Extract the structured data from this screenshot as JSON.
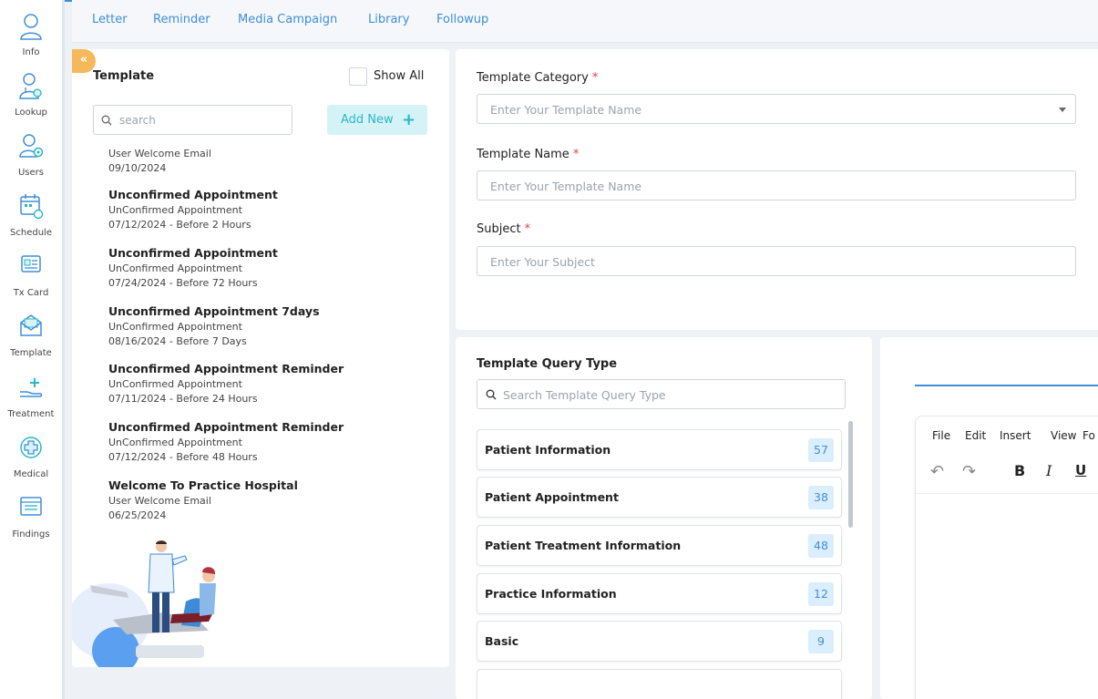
{
  "sidebar": {
    "items": [
      {
        "label": "Info",
        "icon": "person-icon"
      },
      {
        "label": "Lookup",
        "icon": "doctor-icon"
      },
      {
        "label": "Users",
        "icon": "users-gear-icon"
      },
      {
        "label": "Schedule",
        "icon": "calendar-icon"
      },
      {
        "label": "Tx Card",
        "icon": "card-icon"
      },
      {
        "label": "Template",
        "icon": "envelope-icon"
      },
      {
        "label": "Treatment",
        "icon": "hand-plus-icon"
      },
      {
        "label": "Medical",
        "icon": "medical-cross-icon"
      },
      {
        "label": "Findings",
        "icon": "findings-list-icon"
      }
    ]
  },
  "tabs": [
    "Letter",
    "Reminder",
    "Media Campaign",
    "Library",
    "Followup"
  ],
  "template_panel": {
    "collapse_glyph": "«",
    "title": "Template",
    "show_all_label": "Show All",
    "search_placeholder": "search",
    "add_new_label": "Add New",
    "add_new_icon": "+",
    "items": [
      {
        "name": "",
        "subtitle": "User Welcome Email",
        "date": "09/10/2024"
      },
      {
        "name": "Unconfirmed Appointment",
        "subtitle": "UnConfirmed Appointment",
        "date": "07/12/2024 - Before 2 Hours"
      },
      {
        "name": "Unconfirmed Appointment",
        "subtitle": "UnConfirmed Appointment",
        "date": "07/24/2024 - Before 72 Hours"
      },
      {
        "name": "Unconfirmed Appointment 7days",
        "subtitle": "UnConfirmed Appointment",
        "date": "08/16/2024 - Before 7 Days"
      },
      {
        "name": "Unconfirmed Appointment Reminder",
        "subtitle": "UnConfirmed Appointment",
        "date": "07/11/2024 - Before 24 Hours"
      },
      {
        "name": "Unconfirmed Appointment Reminder",
        "subtitle": "UnConfirmed Appointment",
        "date": "07/12/2024 - Before 48 Hours"
      },
      {
        "name": "Welcome To Practice Hospital",
        "subtitle": "User Welcome Email",
        "date": "06/25/2024"
      }
    ]
  },
  "form": {
    "category_label": "Template Category",
    "category_placeholder": "Enter Your Template Name",
    "name_label": "Template Name",
    "name_placeholder": "Enter Your Template Name",
    "subject_label": "Subject",
    "subject_placeholder": "Enter Your Subject",
    "required_mark": "*"
  },
  "query_panel": {
    "title": "Template Query Type",
    "search_placeholder": "Search Template Query Type",
    "items": [
      {
        "name": "Patient Information",
        "count": "57"
      },
      {
        "name": "Patient Appointment",
        "count": "38"
      },
      {
        "name": "Patient Treatment Information",
        "count": "48"
      },
      {
        "name": "Practice Information",
        "count": "12"
      },
      {
        "name": "Basic",
        "count": "9"
      }
    ]
  },
  "editor": {
    "menus": [
      "File",
      "Edit",
      "Insert",
      "View",
      "Fo"
    ],
    "tools": {
      "undo": "↶",
      "redo": "↷",
      "bold": "B",
      "italic": "I",
      "underline": "U"
    }
  },
  "colors": {
    "accent": "#3f8fd8",
    "add_new_bg": "#d5f3f6",
    "add_new_text": "#2ab6c5",
    "collapse": "#f5b95b",
    "required": "#e0404c",
    "count_bg": "#dbeefd"
  }
}
